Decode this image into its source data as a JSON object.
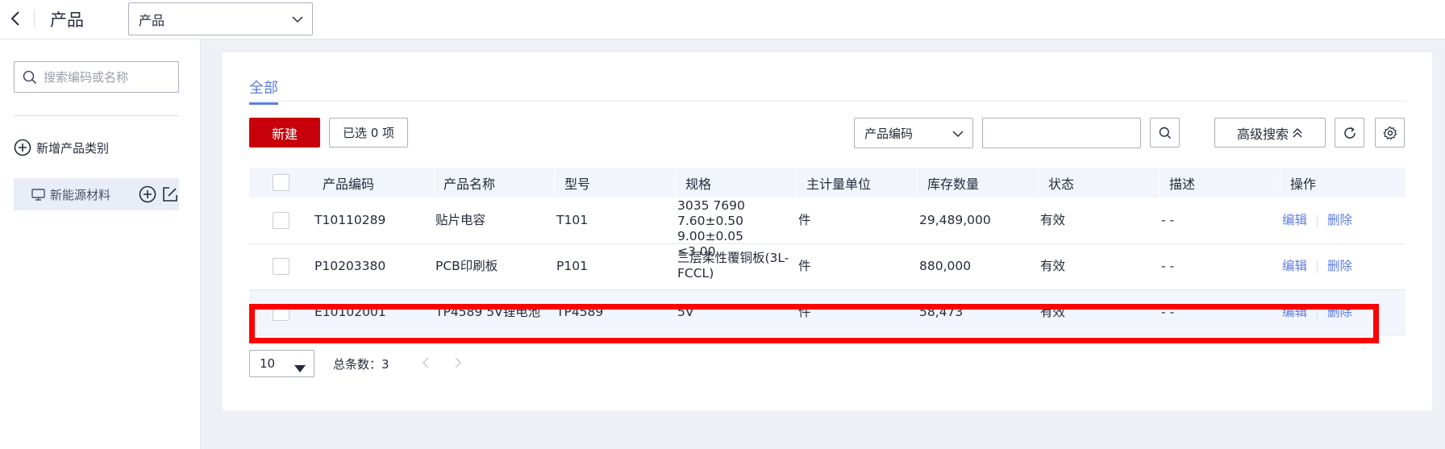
{
  "header": {
    "title": "产品",
    "select_value": "产品"
  },
  "sidebar": {
    "search_placeholder": "搜索编码或名称",
    "add_category_label": "新增产品类别",
    "category_item": "新能源材料"
  },
  "main": {
    "tabs": [
      {
        "label": "全部",
        "active": true
      }
    ],
    "new_button": "新建",
    "selected_button": "已选 0 项",
    "field_select_value": "产品编码",
    "search_value": "",
    "advanced_search_label": "高级搜索",
    "table": {
      "columns": [
        "产品编码",
        "产品名称",
        "型号",
        "规格",
        "主计量单位",
        "库存数量",
        "状态",
        "描述",
        "操作"
      ],
      "rows": [
        {
          "code": "T10110289",
          "name": "贴片电容",
          "model": "T101",
          "spec": "3035 7690 7.60±0.50 9.00±0.05 ≤3.00",
          "spec_lines": [
            "3035 7690",
            "7.60±0.50 9.00±0.05",
            "≤3.00"
          ],
          "unit": "件",
          "qty": "29,489,000",
          "status": "有效",
          "desc": "- -",
          "edit": "编辑",
          "delete": "删除"
        },
        {
          "code": "P10203380",
          "name": "PCB印刷板",
          "model": "P101",
          "spec": "三层柔性覆铜板(3L-FCCL)",
          "spec_lines": [
            "三层柔性覆铜板(3L-",
            "FCCL)"
          ],
          "unit": "件",
          "qty": "880,000",
          "status": "有效",
          "desc": "- -",
          "edit": "编辑",
          "delete": "删除"
        },
        {
          "code": "E10102001",
          "name": "TP4589 5V锂电池",
          "model": "TP4589",
          "spec": "5V",
          "spec_lines": [
            "5V"
          ],
          "unit": "件",
          "qty": "58,473",
          "status": "有效",
          "desc": "- -",
          "edit": "编辑",
          "delete": "删除"
        }
      ]
    },
    "pagination": {
      "page_size": "10",
      "total_label": "总条数：3"
    }
  },
  "colors": {
    "brand_red": "#c7000b",
    "link_blue": "#5e7ce0",
    "highlight_red": "#ff0000"
  }
}
